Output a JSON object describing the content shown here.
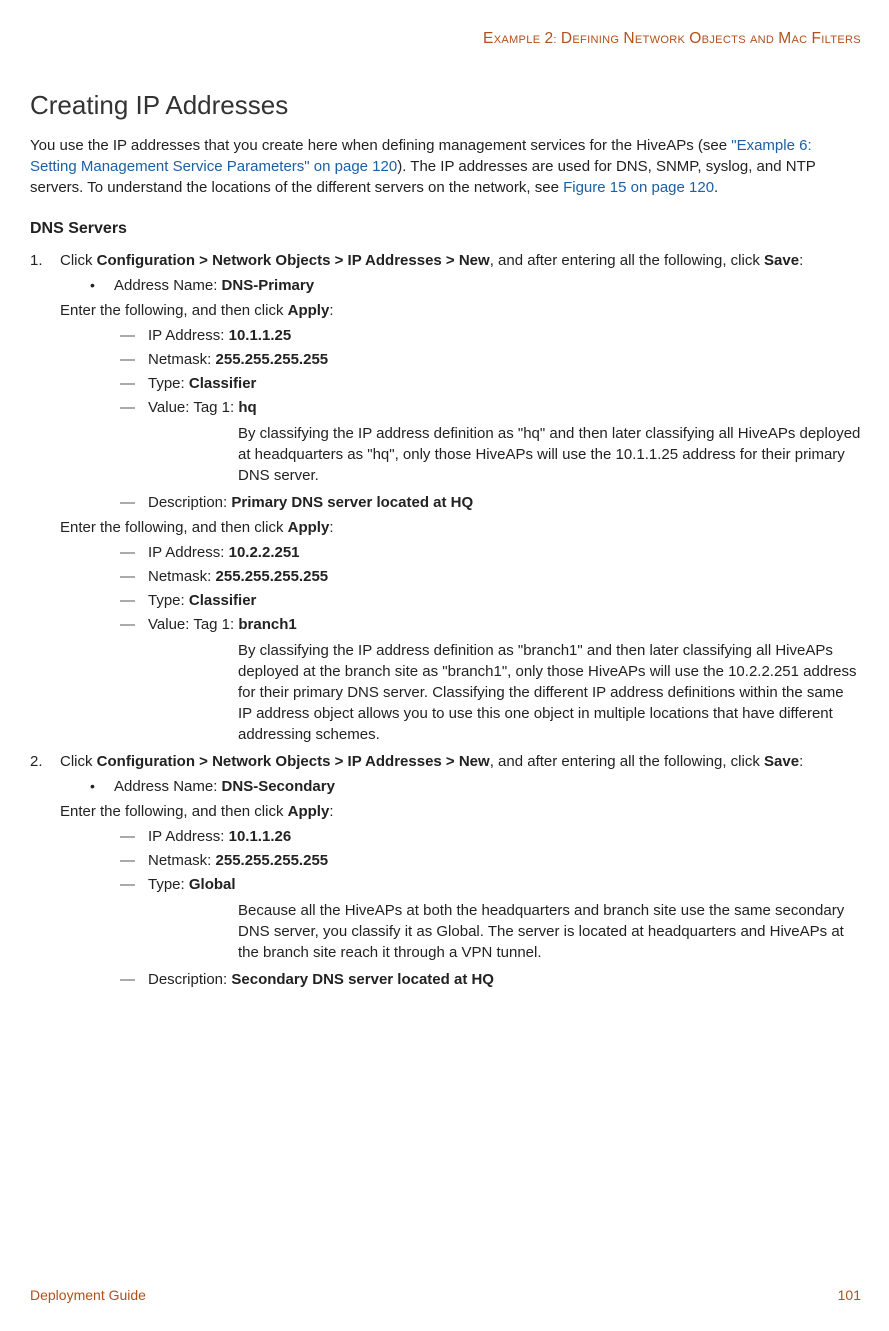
{
  "header": {
    "running": "Example 2: Defining Network Objects and MAC Filters"
  },
  "title": "Creating IP Addresses",
  "intro": {
    "text1": "You use the IP addresses that you create here when defining management services for the HiveAPs (see ",
    "link1": "\"Example 6: Setting Management Service Parameters\" on page 120",
    "text2": "). The IP addresses are used for DNS, SNMP, syslog, and NTP servers. To understand the locations of the different servers on the network, see ",
    "link2": "Figure 15 on page 120",
    "text3": "."
  },
  "subsection": "DNS Servers",
  "steps": [
    {
      "num": "1.",
      "lead": "Click ",
      "bold1": "Configuration > Network Objects > IP Addresses > New",
      "mid": ", and after entering all the following, click ",
      "bold2": "Save",
      "tail": ":",
      "bullets": [
        {
          "label": "Address Name: ",
          "value": "DNS-Primary"
        }
      ],
      "apply_intro_lead": "Enter the following, and then click ",
      "apply_intro_bold": "Apply",
      "apply_intro_tail": ":",
      "groups": [
        {
          "items": [
            {
              "label": "IP Address: ",
              "value": "10.1.1.25"
            },
            {
              "label": "Netmask: ",
              "value": "255.255.255.255"
            },
            {
              "label": "Type: ",
              "value": "Classifier"
            },
            {
              "label": "Value: Tag 1: ",
              "value": "hq",
              "note": "By classifying the IP address definition as \"hq\" and then later classifying all HiveAPs deployed at headquarters as \"hq\", only those HiveAPs will use the 10.1.1.25 address for their primary DNS server."
            },
            {
              "label": "Description: ",
              "value": "Primary DNS server located at HQ"
            }
          ]
        },
        {
          "apply_intro": true,
          "items": [
            {
              "label": "IP Address: ",
              "value": "10.2.2.251"
            },
            {
              "label": "Netmask: ",
              "value": "255.255.255.255"
            },
            {
              "label": "Type: ",
              "value": "Classifier"
            },
            {
              "label": "Value: Tag 1: ",
              "value": "branch1",
              "note": "By classifying the IP address definition as \"branch1\" and then later classifying all HiveAPs deployed at the branch site as \"branch1\", only those HiveAPs will use the 10.2.2.251 address for their primary DNS server. Classifying the different IP address definitions within the same IP address object allows you to use this one object in multiple locations that have different addressing schemes."
            }
          ]
        }
      ]
    },
    {
      "num": "2.",
      "lead": "Click ",
      "bold1": "Configuration > Network Objects > IP Addresses > New",
      "mid": ", and after entering all the following, click ",
      "bold2": "Save",
      "tail": ":",
      "bullets": [
        {
          "label": "Address Name: ",
          "value": "DNS-Secondary"
        }
      ],
      "apply_intro_lead": "Enter the following, and then click ",
      "apply_intro_bold": "Apply",
      "apply_intro_tail": ":",
      "groups": [
        {
          "items": [
            {
              "label": "IP Address: ",
              "value": "10.1.1.26"
            },
            {
              "label": "Netmask: ",
              "value": "255.255.255.255"
            },
            {
              "label": "Type: ",
              "value": "Global",
              "note": "Because all the HiveAPs at both the headquarters and branch site use the same secondary DNS server, you classify it as Global. The server is located at headquarters and HiveAPs at the branch site reach it through a VPN tunnel."
            },
            {
              "label": "Description: ",
              "value": "Secondary DNS server located at HQ"
            }
          ]
        }
      ]
    }
  ],
  "footer": {
    "left": "Deployment Guide",
    "right": "101"
  }
}
